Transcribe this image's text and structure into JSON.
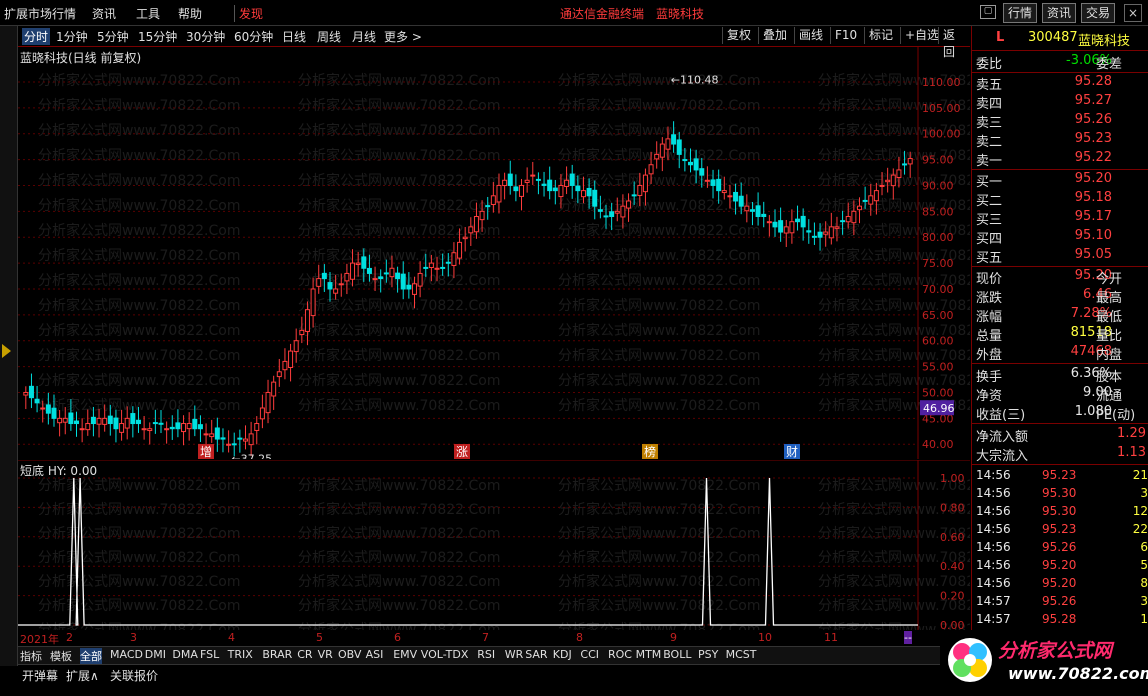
{
  "menu": {
    "items": [
      "扩展市场行情",
      "资讯",
      "工具",
      "帮助"
    ],
    "discover": "发现",
    "app_title": "通达信金融终端",
    "stock_title": "蓝晓科技",
    "right_buttons": [
      "行情",
      "资讯",
      "交易"
    ]
  },
  "periods": {
    "items": [
      "分时",
      "1分钟",
      "5分钟",
      "15分钟",
      "30分钟",
      "60分钟",
      "日线",
      "周线",
      "月线",
      "更多 >"
    ],
    "active_index": 0
  },
  "tools": [
    "复权",
    "叠加",
    "画线",
    "F10",
    "标记",
    "+自选",
    "返回"
  ],
  "main_chart": {
    "label": "蓝晓科技(日线 前复权)",
    "high_label": "110.48",
    "low_label": "37.25",
    "price_tag": "46.96",
    "watermark": "分析家公式网www.70822.Com",
    "events": [
      "增",
      "涨",
      "榜",
      "财"
    ]
  },
  "indicator": {
    "label": "短底 HY: 0.00"
  },
  "chart_data": [
    {
      "type": "candlestick",
      "title": "蓝晓科技(日线 前复权)",
      "y_ticks": [
        110.0,
        105.0,
        100.0,
        95.0,
        90.0,
        85.0,
        80.0,
        75.0,
        70.0,
        65.0,
        60.0,
        55.0,
        50.0,
        45.0,
        40.0
      ],
      "ylim": [
        38.5,
        112.5
      ],
      "annotations": {
        "max": 110.48,
        "min": 37.25,
        "last_marker": 46.96
      },
      "close_series": [
        50,
        49,
        48,
        47,
        46,
        45,
        45,
        45,
        44,
        44,
        43,
        44,
        44,
        45,
        45,
        44,
        43,
        44,
        45,
        44,
        44,
        43,
        43,
        44,
        44,
        43,
        43,
        43,
        44,
        44,
        43,
        43,
        42,
        42,
        41,
        41,
        40,
        40,
        41,
        41,
        42,
        44,
        47,
        50,
        52,
        54,
        56,
        58,
        60,
        62,
        66,
        70,
        72,
        72,
        70,
        70,
        71,
        73,
        75,
        75,
        74,
        73,
        72,
        72,
        73,
        74,
        72,
        70,
        70,
        71,
        73,
        74,
        75,
        74,
        74,
        75,
        77,
        79,
        80,
        82,
        84,
        85,
        86,
        88,
        90,
        91,
        90,
        89,
        90,
        91,
        92,
        91,
        90,
        89,
        89,
        90,
        91,
        90,
        89,
        89,
        88,
        86,
        85,
        84,
        84,
        85,
        86,
        87,
        88,
        90,
        92,
        94,
        96,
        98,
        99,
        98,
        96,
        95,
        94,
        93,
        92,
        91,
        90,
        89,
        89,
        88,
        87,
        86,
        86,
        85,
        84,
        84,
        83,
        82,
        81,
        82,
        83,
        83,
        82,
        81,
        80,
        80,
        81,
        82,
        82,
        83,
        84,
        85,
        86,
        87,
        88,
        89,
        90,
        91,
        92,
        93,
        94,
        95.2
      ],
      "x_labels": [
        "2021年",
        "2",
        "3",
        "4",
        "5",
        "6",
        "7",
        "8",
        "9",
        "10",
        "11",
        "--"
      ]
    },
    {
      "type": "line",
      "title": "短底 HY: 0.00",
      "y_ticks": [
        1.0,
        0.8,
        0.6,
        0.4,
        0.2,
        0.0
      ],
      "ylim": [
        0,
        1
      ],
      "spikes_at_fraction": [
        0.062,
        0.069,
        0.765,
        0.835
      ],
      "values_note": "binary signal 0/1"
    }
  ],
  "date_axis": [
    "2021年",
    "2",
    "3",
    "4",
    "5",
    "6",
    "7",
    "8",
    "9",
    "10",
    "11",
    "--"
  ],
  "indicator_tabs": [
    "指标",
    "模板",
    "全部",
    "MACD",
    "DMI",
    "DMA",
    "FSL",
    "TRIX",
    "BRAR",
    "CR",
    "VR",
    "OBV",
    "ASI",
    "EMV",
    "VOL-TDX",
    "RSI",
    "WR",
    "SAR",
    "KDJ",
    "CCI",
    "ROC",
    "MTM",
    "BOLL",
    "PSY",
    "MCST"
  ],
  "bottom_buttons": [
    "开弹幕",
    "扩展∧",
    "关联报价"
  ],
  "quote": {
    "flag": "L",
    "code": "300487",
    "name": "蓝晓科技",
    "weibi_label": "委比",
    "weibi": "-3.06%",
    "weicha_label": "委差",
    "asks": [
      {
        "label": "卖五",
        "price": "95.28"
      },
      {
        "label": "卖四",
        "price": "95.27"
      },
      {
        "label": "卖三",
        "price": "95.26"
      },
      {
        "label": "卖二",
        "price": "95.23"
      },
      {
        "label": "卖一",
        "price": "95.22"
      }
    ],
    "bids": [
      {
        "label": "买一",
        "price": "95.20"
      },
      {
        "label": "买二",
        "price": "95.18"
      },
      {
        "label": "买三",
        "price": "95.17"
      },
      {
        "label": "买四",
        "price": "95.10"
      },
      {
        "label": "买五",
        "price": "95.05"
      }
    ],
    "stats": [
      {
        "label": "现价",
        "value": "95.20",
        "label2": "今开",
        "color": "red"
      },
      {
        "label": "涨跌",
        "value": "6.46",
        "label2": "最高",
        "color": "red"
      },
      {
        "label": "涨幅",
        "value": "7.28%",
        "label2": "最低",
        "color": "red"
      },
      {
        "label": "总量",
        "value": "81518",
        "label2": "量比",
        "color": "yellow"
      },
      {
        "label": "外盘",
        "value": "47468",
        "label2": "内盘",
        "color": "red"
      }
    ],
    "stats2": [
      {
        "label": "换手",
        "value": "6.36%",
        "label2": "股本",
        "color": "white"
      },
      {
        "label": "净资",
        "value": "9.00",
        "label2": "流通",
        "color": "white"
      },
      {
        "label": "收益(三)",
        "value": "1.080",
        "label2": "PE(动)",
        "color": "white"
      }
    ],
    "flows": [
      {
        "label": "净流入额",
        "value": "1.29"
      },
      {
        "label": "大宗流入",
        "value": "1.13"
      }
    ],
    "ticks": [
      {
        "time": "14:56",
        "price": "95.23",
        "vol": "21"
      },
      {
        "time": "14:56",
        "price": "95.30",
        "vol": "3"
      },
      {
        "time": "14:56",
        "price": "95.30",
        "vol": "12"
      },
      {
        "time": "14:56",
        "price": "95.23",
        "vol": "22"
      },
      {
        "time": "14:56",
        "price": "95.26",
        "vol": "6"
      },
      {
        "time": "14:56",
        "price": "95.20",
        "vol": "5"
      },
      {
        "time": "14:56",
        "price": "95.20",
        "vol": "8"
      },
      {
        "time": "14:57",
        "price": "95.26",
        "vol": "3"
      },
      {
        "time": "14:57",
        "price": "95.28",
        "vol": "1"
      }
    ]
  },
  "logo": {
    "text": "分析家公式网",
    "url_text": "www.70822.com"
  }
}
